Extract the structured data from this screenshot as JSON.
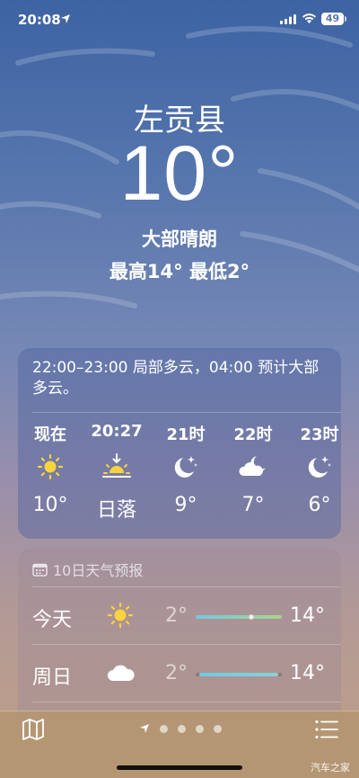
{
  "status_bar": {
    "time": "20:08",
    "battery": "49"
  },
  "header": {
    "city": "左贡县",
    "temperature": "10°",
    "condition": "大部晴朗",
    "high_low": "最高14°  最低2°"
  },
  "hourly": {
    "summary": "22:00–23:00 局部多云，04:00 预计大部多云。",
    "hours": [
      {
        "label": "现在",
        "icon": "sun-icon",
        "temp": "10°"
      },
      {
        "label": "20:27",
        "icon": "sunset-icon",
        "temp": "日落"
      },
      {
        "label": "21时",
        "icon": "moon-stars-icon",
        "temp": "9°"
      },
      {
        "label": "22时",
        "icon": "cloud-moon-icon",
        "temp": "7°"
      },
      {
        "label": "23时",
        "icon": "moon-stars-icon",
        "temp": "6°"
      }
    ]
  },
  "daily": {
    "heading": "10日天气预报",
    "days": [
      {
        "name": "今天",
        "icon": "sun-icon",
        "low": "2°",
        "high": "14°",
        "current_position": 0.65
      },
      {
        "name": "周日",
        "icon": "cloud-icon",
        "low": "2°",
        "high": "14°"
      }
    ]
  },
  "bottom_bar": {
    "icons": [
      "map-icon",
      "location-arrow-icon",
      "list-icon"
    ],
    "page_count": 4
  },
  "watermark": "汽车之家",
  "colors": {
    "sun": "#f9d33b",
    "bar_cool": "#6ccbe4",
    "bar_warm": "#a9d58a"
  }
}
